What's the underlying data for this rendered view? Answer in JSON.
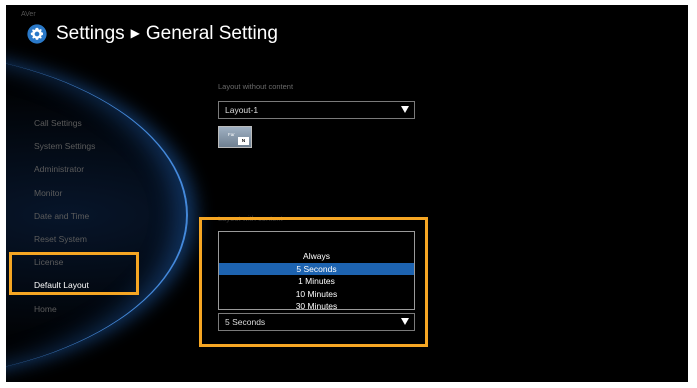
{
  "brand": "AVer",
  "header": {
    "icon": "gear-icon",
    "section": "Settings",
    "separator": "▶",
    "page": "General Setting"
  },
  "sidebar": {
    "items": [
      {
        "label": "Call Settings",
        "active": false
      },
      {
        "label": "System Settings",
        "active": false
      },
      {
        "label": "Administrator",
        "active": false
      },
      {
        "label": "Monitor",
        "active": false
      },
      {
        "label": "Date and Time",
        "active": false
      },
      {
        "label": "Reset System",
        "active": false
      },
      {
        "label": "License",
        "active": false
      },
      {
        "label": "Default Layout",
        "active": true
      },
      {
        "label": "Home",
        "active": false
      }
    ]
  },
  "layout_without_content": {
    "label": "Layout without content",
    "value": "Layout-1",
    "preview": {
      "far": "Far",
      "near": "N"
    }
  },
  "layout_with_content": {
    "label": "Layout with content",
    "dropdown_options": [
      "Always",
      "5 Seconds",
      "1 Minutes",
      "10 Minutes",
      "30 Minutes"
    ],
    "selected_option": "5 Seconds",
    "value": "5 Seconds"
  },
  "colors": {
    "accent_highlight": "#f6a623",
    "selected_option": "#1d63b0",
    "arc_glow": "#3c8cff"
  }
}
